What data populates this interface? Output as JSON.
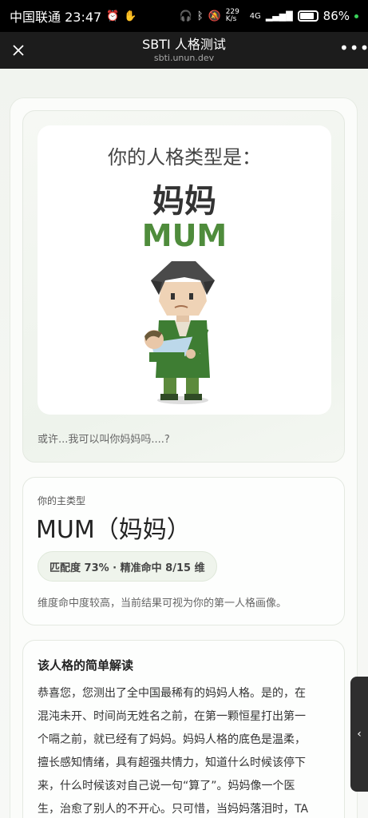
{
  "status": {
    "carrier_time": "中国联通 23:47",
    "speed": "229 K/s",
    "network": "4G",
    "battery": "86%"
  },
  "titlebar": {
    "title": "SBTI 人格测试",
    "url": "sbti.unun.dev",
    "close_icon": "close-icon",
    "more_icon": "more-icon"
  },
  "hero": {
    "heading": "你的人格类型是：",
    "name": "妈妈",
    "code": "MUM",
    "caption": "或许...我可以叫你妈妈吗....?",
    "accent_color": "#4f8c3c"
  },
  "main_type": {
    "label": "你的主类型",
    "value": "MUM（妈妈）",
    "match": "匹配度 73% · 精准命中 8/15 维",
    "note": "维度命中度较高，当前结果可视为你的第一人格画像。"
  },
  "reading": {
    "title": "该人格的简单解读",
    "lines": [
      "恭喜您，您测出了全中国最稀有的妈妈人格。是的，在",
      "混沌未开、时间尚无姓名之前，在第一颗恒星打出第一",
      "个嗝之前，就已经有了妈妈。妈妈人格的底色是温柔，",
      "擅长感知情绪，具有超强共情力，知道什么时候该停下",
      "来，什么时候该对自己说一句“算了”。妈妈像一个医",
      "生，治愈了别人的不开心。只可惜，当妈妈落泪时，TA"
    ]
  },
  "side_tab": {
    "icon": "chevron-left-icon"
  }
}
